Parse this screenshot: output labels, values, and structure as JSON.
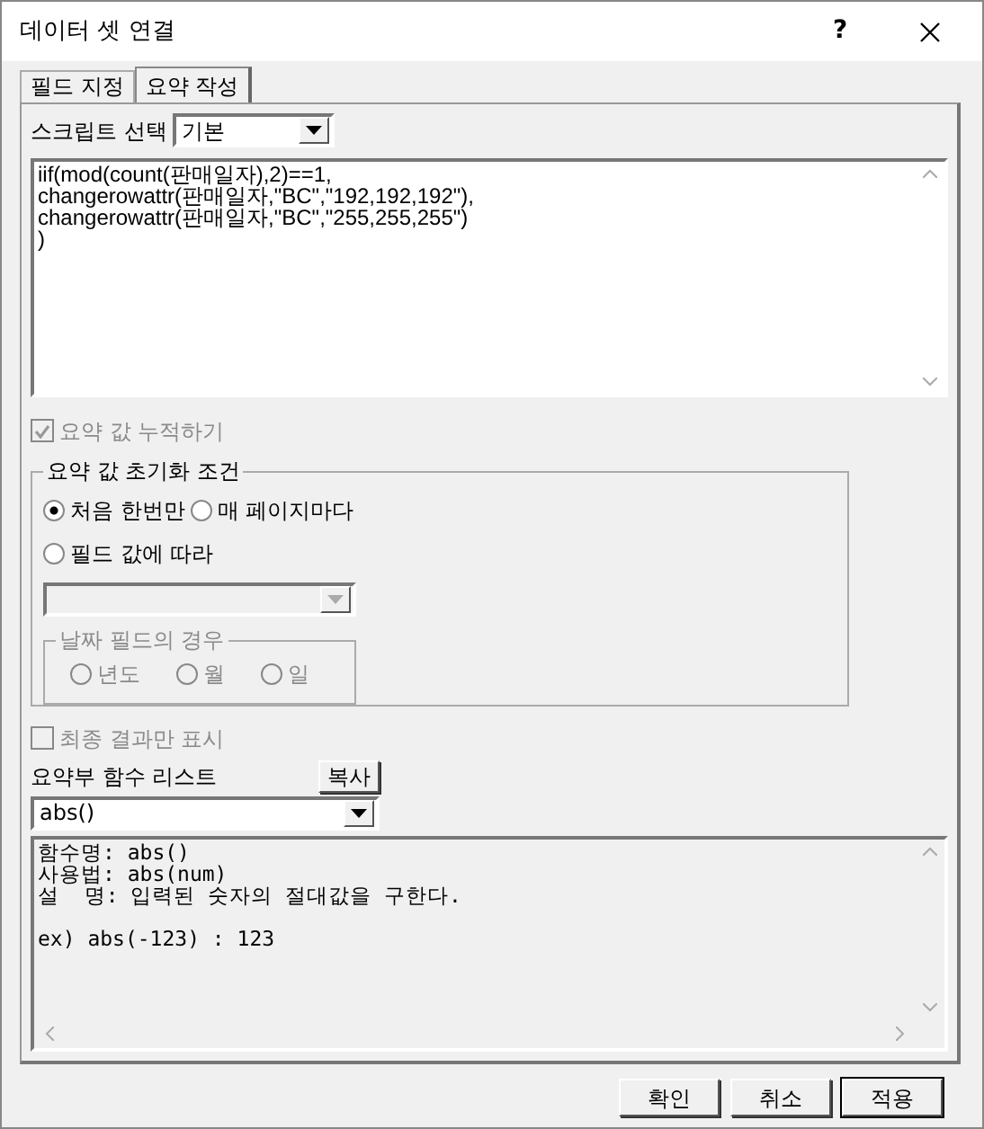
{
  "window": {
    "title": "데이터 셋 연결",
    "help": "?"
  },
  "tabs": [
    {
      "label": "필드 지정",
      "selected": false
    },
    {
      "label": "요약 작성",
      "selected": true
    }
  ],
  "script_select": {
    "label": "스크립트 선택",
    "value": "기본"
  },
  "script_text": "iif(mod(count(판매일자),2)==1,\nchangerowattr(판매일자,\"BC\",\"192,192,192\"),\nchangerowattr(판매일자,\"BC\",\"255,255,255\")\n)",
  "accumulate": {
    "label": "요약 값 누적하기",
    "checked": true,
    "disabled": true
  },
  "reset_group": {
    "title": "요약 값 초기화 조건",
    "options": [
      {
        "label": "처음 한번만",
        "selected": true
      },
      {
        "label": "매 페이지마다",
        "selected": false
      },
      {
        "label": "필드 값에 따라",
        "selected": false
      }
    ],
    "field_dropdown": {
      "disabled": true
    },
    "date_group": {
      "title": "날짜 필드의 경우",
      "disabled": true,
      "options": [
        {
          "label": "년도",
          "selected": false
        },
        {
          "label": "월",
          "selected": false
        },
        {
          "label": "일",
          "selected": false
        }
      ]
    }
  },
  "final_only": {
    "label": "최종 결과만 표시",
    "checked": false,
    "disabled": true
  },
  "function_list": {
    "label": "요약부 함수 리스트",
    "copy_button": "복사",
    "value": "abs()"
  },
  "description": "함수명: abs()\n사용법: abs(num)\n설  명: 입력된 숫자의 절대값을 구한다.\n\nex) abs(-123) : 123",
  "buttons": [
    {
      "label": "확인",
      "default": false
    },
    {
      "label": "취소",
      "default": false
    },
    {
      "label": "적용",
      "default": true
    }
  ]
}
